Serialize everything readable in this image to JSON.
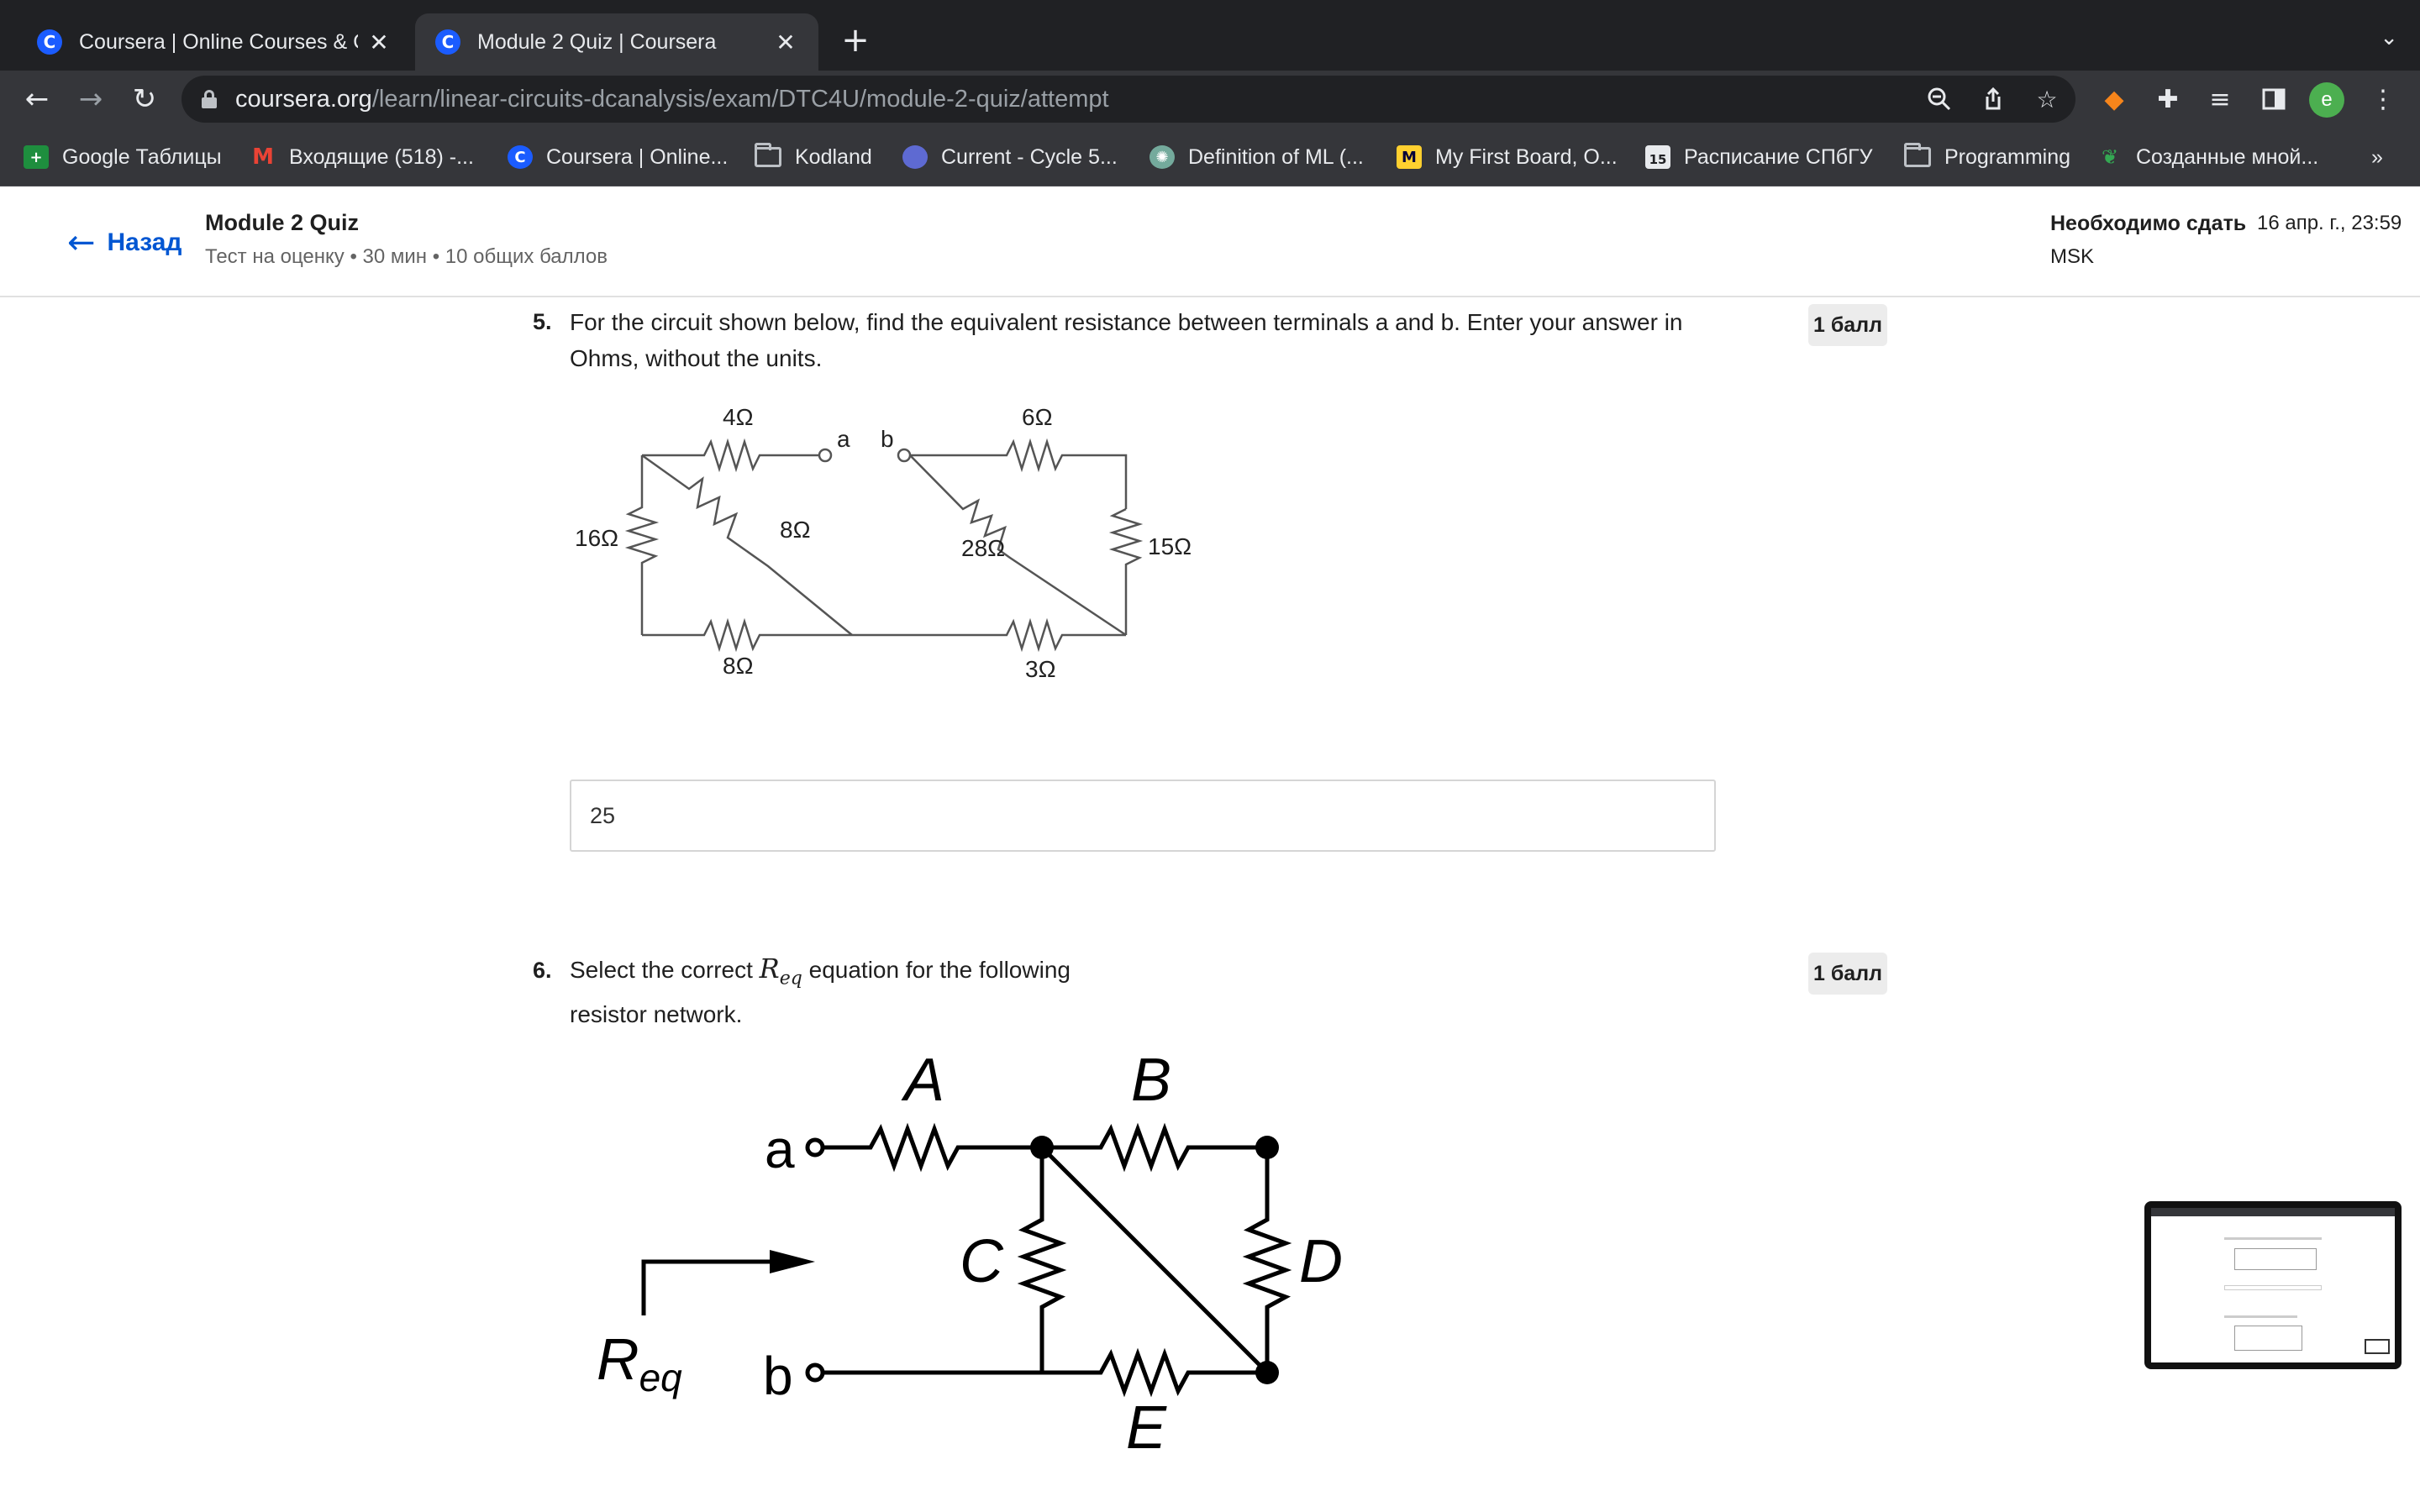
{
  "browser": {
    "tabs": [
      {
        "title": "Coursera | Online Courses & Cr",
        "favicon": "C",
        "active": false
      },
      {
        "title": "Module 2 Quiz | Coursera",
        "favicon": "C",
        "active": true
      }
    ],
    "url_host": "coursera.org",
    "url_path": "/learn/linear-circuits-dcanalysis/exam/DTC4U/module-2-quiz/attempt",
    "profile_initial": "e",
    "bookmarks": [
      {
        "label": "Google Таблицы",
        "icon": "sheets-icon"
      },
      {
        "label": "Входящие (518) -...",
        "icon": "gmail-icon"
      },
      {
        "label": "Coursera | Online...",
        "icon": "coursera-icon"
      },
      {
        "label": "Kodland",
        "icon": "folder-icon"
      },
      {
        "label": "Current - Cycle 5...",
        "icon": "linear-icon"
      },
      {
        "label": "Definition of ML (...",
        "icon": "openai-icon"
      },
      {
        "label": "My First Board, O...",
        "icon": "miro-icon"
      },
      {
        "label": "Расписание СПбГУ",
        "icon": "calendar-icon"
      },
      {
        "label": "Programming",
        "icon": "folder-icon"
      },
      {
        "label": "Созданные мной...",
        "icon": "leaf-icon"
      }
    ],
    "calendar_day": "15",
    "more_bookmarks": "»"
  },
  "header": {
    "back_label": "Назад",
    "title": "Module 2 Quiz",
    "meta": "Тест на оценку • 30 мин • 10 общих баллов",
    "due_label": "Необходимо сдать",
    "due_date": "16 апр. г., 23:59",
    "due_tz": "MSK"
  },
  "questions": [
    {
      "number": "5.",
      "text_line1": "For the circuit shown below, find the equivalent resistance between terminals a and b. Enter your answer in",
      "text_line2": "Ohms, without the units.",
      "points": "1 балл",
      "answer": "25",
      "figure": {
        "labels": {
          "r_top_left": "4Ω",
          "r_top_right": "6Ω",
          "r_left": "16Ω",
          "r_diag_left": "8Ω",
          "r_diag_right": "28Ω",
          "r_right": "15Ω",
          "r_bottom_left": "8Ω",
          "r_bottom_right": "3Ω",
          "term_a": "a",
          "term_b": "b"
        }
      }
    },
    {
      "number": "6.",
      "text_before": "Select the correct ",
      "req_main": "R",
      "req_sub": "eq",
      "text_after": " equation for the following",
      "text_line2": "resistor network.",
      "points": "1 балл",
      "figure": {
        "labels": {
          "A": "A",
          "B": "B",
          "C": "C",
          "D": "D",
          "E": "E",
          "term_a": "a",
          "term_b": "b",
          "req_main": "R",
          "req_sub": "eq"
        }
      }
    }
  ]
}
